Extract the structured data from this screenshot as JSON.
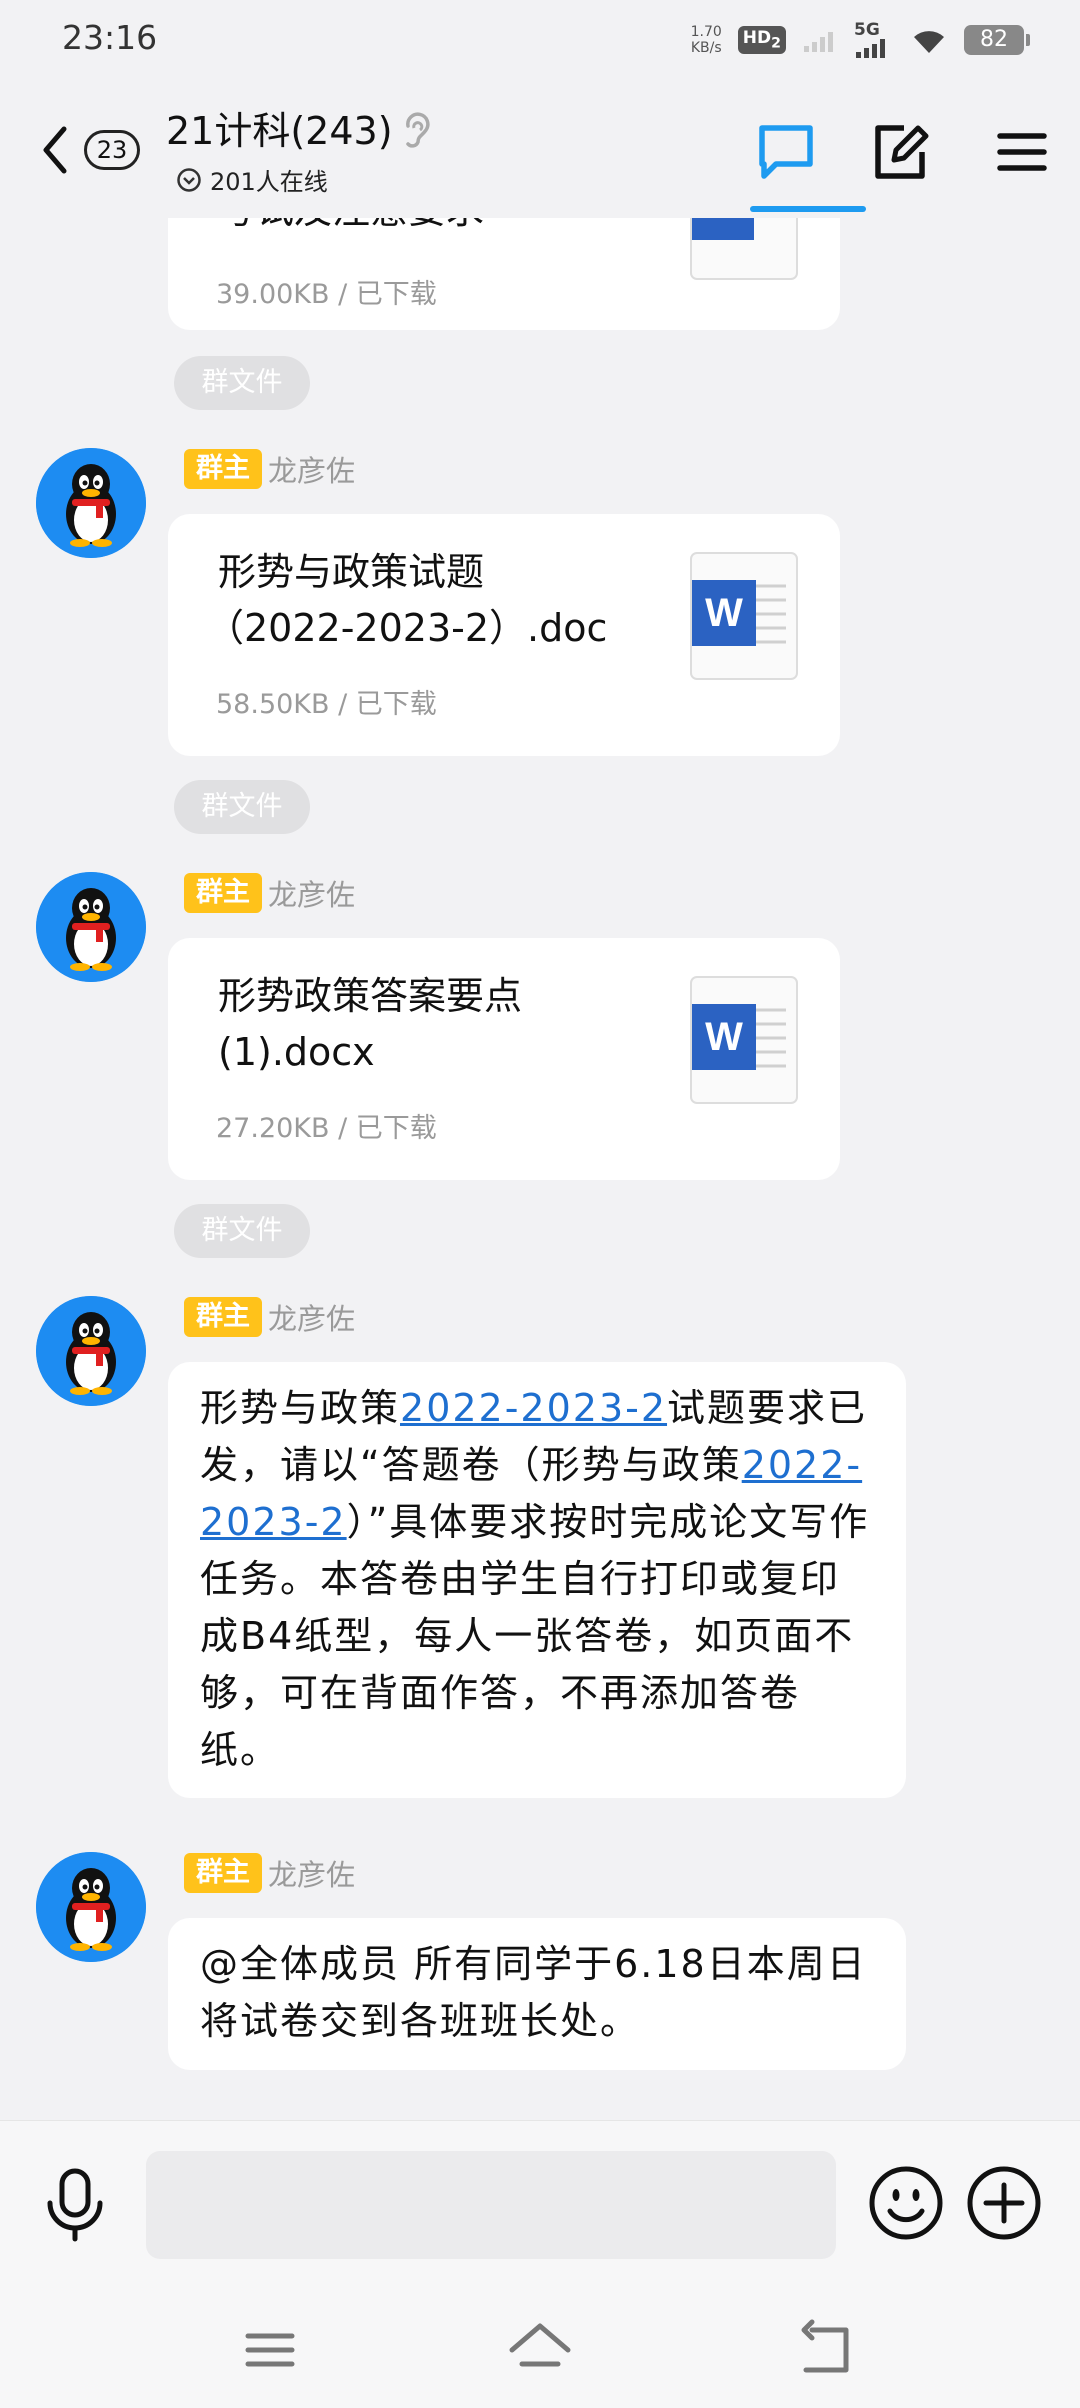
{
  "status_bar": {
    "time": "23:16",
    "net_speed_value": "1.70",
    "net_speed_unit": "KB/s",
    "hd": "HD",
    "hd_sub": "2",
    "network": "5G",
    "battery": "82"
  },
  "header": {
    "unread_count": "23",
    "title": "21计科(243)",
    "online": "201人在线"
  },
  "messages": [
    {
      "type": "file",
      "name": "考试及注意要求",
      "meta": "39.00KB / 已下载",
      "partial": true
    },
    {
      "type": "pill",
      "label": "群文件"
    },
    {
      "type": "file",
      "role": "群主",
      "sender": "龙彦佐",
      "name_line1": "形势与政策试题",
      "name_line2": "（2022-2023-2）.doc",
      "meta": "58.50KB / 已下载"
    },
    {
      "type": "pill",
      "label": "群文件"
    },
    {
      "type": "file",
      "role": "群主",
      "sender": "龙彦佐",
      "name_line1": "形势政策答案要点",
      "name_line2": "(1).docx",
      "meta": "27.20KB / 已下载"
    },
    {
      "type": "pill",
      "label": "群文件"
    },
    {
      "type": "text",
      "role": "群主",
      "sender": "龙彦佐",
      "t1": "形势与政策",
      "l1": "2022-2023-2",
      "t2": "试题要求已发，请以“答题卷（形势与政策",
      "l2": "2022-2023-2",
      "t3": "）”具体要求按时完成论文写作任务。本答卷由学生自行打印或复印成B4纸型，每人一张答卷，如页面不够，可在背面作答，不再添加答卷纸。"
    },
    {
      "type": "text",
      "role": "群主",
      "sender": "龙彦佐",
      "text": "@全体成员 所有同学于6.18日本周日将试卷交到各班班长处。"
    }
  ],
  "input": {
    "value": "",
    "placeholder": ""
  },
  "colors": {
    "accent": "#1e9bf0",
    "owner_tag": "#ffc21a",
    "link": "#1e6fd0",
    "avatar_bg": "#1d8cf2"
  },
  "icons": [
    "back-icon",
    "ear-icon",
    "chat-icon",
    "edit-icon",
    "menu-icon",
    "mic-icon",
    "emoji-icon",
    "plus-icon",
    "word-file-icon",
    "qq-penguin-avatar",
    "nav-menu-icon",
    "nav-home-icon",
    "nav-back-icon"
  ]
}
